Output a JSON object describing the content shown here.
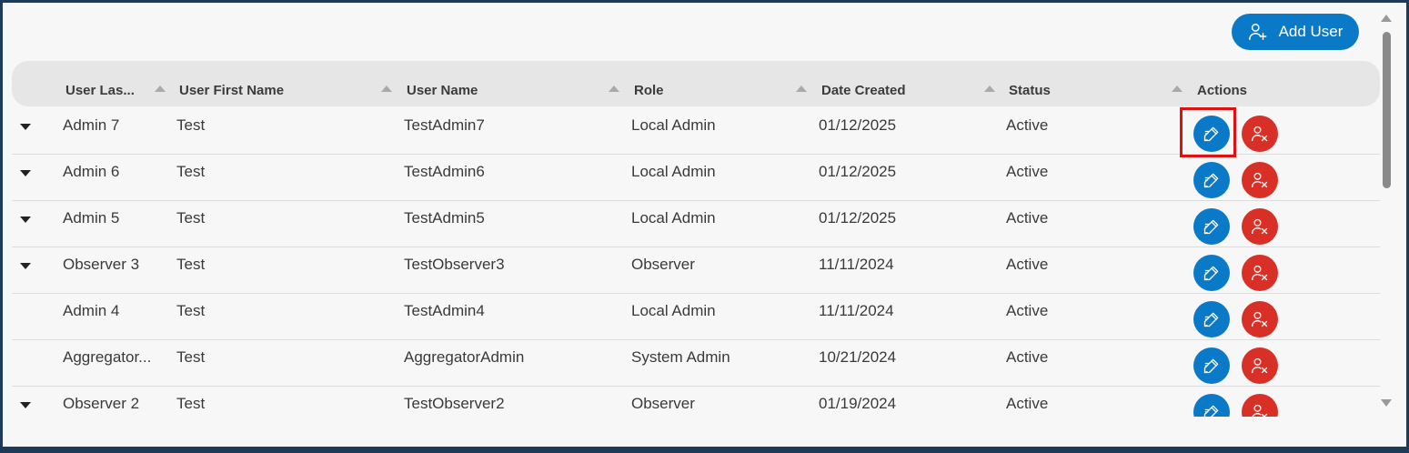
{
  "toolbar": {
    "add_user_label": "Add User"
  },
  "table": {
    "columns": [
      "User Las...",
      "User First Name",
      "User Name",
      "Role",
      "Date Created",
      "Status",
      "Actions"
    ],
    "rows": [
      {
        "last": "Admin 7",
        "first": "Test",
        "username": "TestAdmin7",
        "role": "Local Admin",
        "date": "01/12/2025",
        "status": "Active",
        "expandable": true
      },
      {
        "last": "Admin 6",
        "first": "Test",
        "username": "TestAdmin6",
        "role": "Local Admin",
        "date": "01/12/2025",
        "status": "Active",
        "expandable": true
      },
      {
        "last": "Admin 5",
        "first": "Test",
        "username": "TestAdmin5",
        "role": "Local Admin",
        "date": "01/12/2025",
        "status": "Active",
        "expandable": true
      },
      {
        "last": "Observer 3",
        "first": "Test",
        "username": "TestObserver3",
        "role": "Observer",
        "date": "11/11/2024",
        "status": "Active",
        "expandable": true
      },
      {
        "last": "Admin 4",
        "first": "Test",
        "username": "TestAdmin4",
        "role": "Local Admin",
        "date": "11/11/2024",
        "status": "Active",
        "expandable": false
      },
      {
        "last": "Aggregator...",
        "first": "Test",
        "username": "AggregatorAdmin",
        "role": "System Admin",
        "date": "10/21/2024",
        "status": "Active",
        "expandable": false
      },
      {
        "last": "Observer 2",
        "first": "Test",
        "username": "TestObserver2",
        "role": "Observer",
        "date": "01/19/2024",
        "status": "Active",
        "expandable": true
      }
    ]
  },
  "icons": {
    "add": "add-user-icon",
    "edit": "edit-pencil-icon",
    "delete": "remove-user-icon",
    "expand": "caret-down-icon",
    "sort": "sort-up-icon"
  },
  "colors": {
    "primary": "#0a79c7",
    "danger": "#d83027",
    "highlight": "#e01010"
  }
}
